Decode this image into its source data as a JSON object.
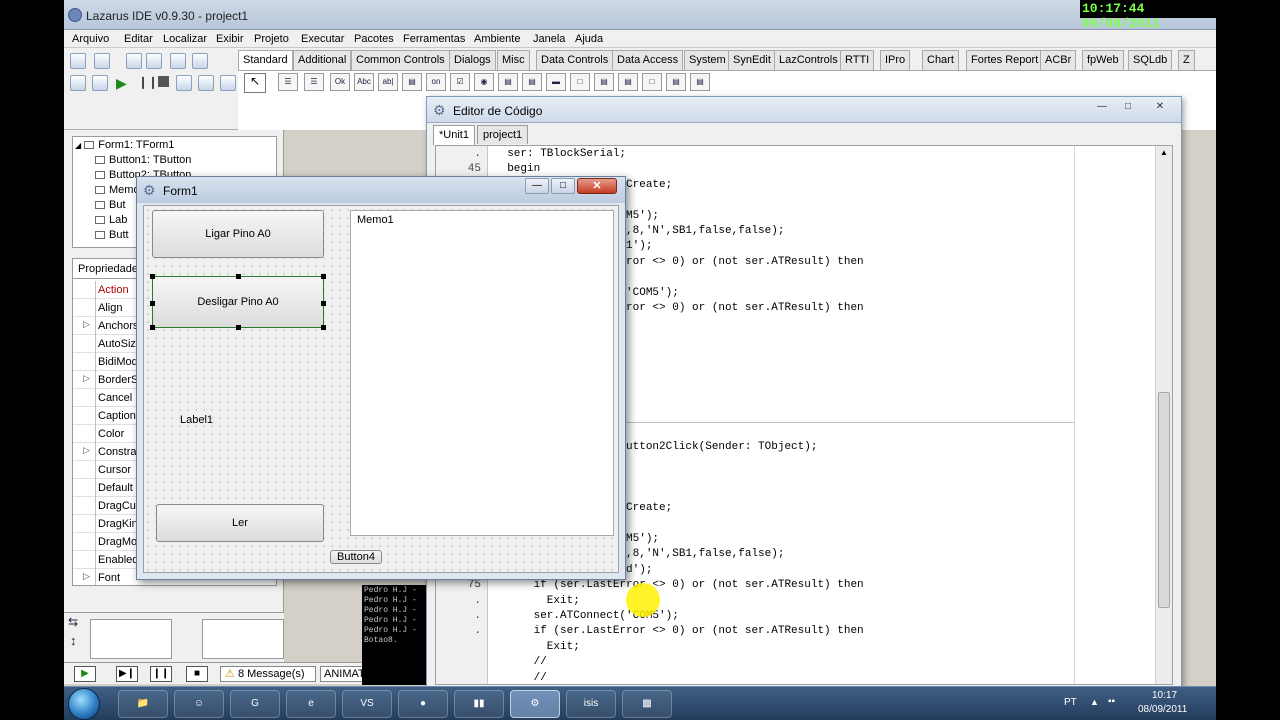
{
  "window_title": "Lazarus IDE v0.9.30 - project1",
  "clock_overlay": "10:17:44  09/08/2011",
  "menu": [
    "Arquivo",
    "Editar",
    "Localizar",
    "Exibir",
    "Projeto",
    "Executar",
    "Pacotes",
    "Ferramentas",
    "Ambiente",
    "Janela",
    "Ajuda"
  ],
  "palette_tabs": [
    "Standard",
    "Additional",
    "Common Controls",
    "Dialogs",
    "Misc",
    "Data Controls",
    "Data Access",
    "System",
    "SynEdit",
    "LazControls",
    "RTTI",
    "IPro",
    "Chart",
    "Fortes Report",
    "ACBr",
    "fpWeb",
    "SQLdb",
    "Z"
  ],
  "palette_components": [
    "Ok",
    "Abc",
    "ab|",
    "on"
  ],
  "object_tree": [
    "Form1: TForm1",
    "Button1: TButton",
    "Button2: TButton",
    "Memo",
    "But",
    "Lab",
    "Butt"
  ],
  "inspector_tab": "Propriedades",
  "properties": [
    "Action",
    "Align",
    "Anchors",
    "AutoSize",
    "BidiMode",
    "BorderSpacing",
    "Cancel",
    "Caption",
    "Color",
    "Constraints",
    "Cursor",
    "Default",
    "DragCursor",
    "DragKind",
    "DragMode",
    "Enabled",
    "Font"
  ],
  "messages_count": "8 Message(s)",
  "status_animat": "ANIMAT",
  "terminal_lines": [
    "Pedro H.J -",
    "Pedro H.J -",
    "Pedro H.J -",
    "Pedro H.J -",
    "Pedro H.J -",
    "Botao8."
  ],
  "editor": {
    "title": "Editor de Código",
    "tabs": [
      "*Unit1",
      "project1"
    ],
    "line_numbers": [
      ".",
      "45",
      ".",
      ".",
      ".",
      ".",
      ".",
      ".",
      ".",
      ".",
      ".",
      "",
      "",
      "",
      "",
      "",
      "",
      "",
      "",
      ".",
      ".",
      ".",
      ".",
      ".",
      ".",
      ".",
      ".",
      ".",
      "75",
      ".",
      ".",
      "."
    ],
    "code_lines": [
      "  ser: TBlockSerial;",
      "  begin",
      "                  l.Create;",
      "",
      "                  COM5');",
      "                  00,8,'N',SB1,false,false);",
      "                  ('1');",
      "                  Error <> 0) or (not ser.ATResult) then",
      "",
      "                  t('COM5');",
      "                  Error <> 0) or (not ser.ATResult) then",
      "",
      "",
      "",
      "",
      "",
      "",
      "",
      "",
      "                  .Button2Click(Sender: TObject);",
      "",
      "                  l;",
      "",
      "                  l.Create;",
      "",
      "                  COM5');",
      "                  00,8,'N',SB1,false,false);",
      "                  ('d');",
      "      if (ser.LastError <> 0) or (not ser.ATResult) then",
      "        Exit;",
      "      ser.ATConnect('COM5');",
      "      if (ser.LastError <> 0) or (not ser.ATResult) then",
      "        Exit;",
      "      //",
      "      //"
    ]
  },
  "form1": {
    "title": "Form1",
    "button_ligar": "Ligar Pino A0",
    "button_desligar": "Desligar Pino A0",
    "label": "Label1",
    "button_ler": "Ler",
    "memo": "Memo1",
    "button4": "Button4"
  },
  "taskbar": {
    "lang": "PT",
    "time": "10:17",
    "date": "08/09/2011",
    "items": [
      "explorer",
      "people",
      "gimp",
      "ie",
      "vsc",
      "rc",
      "mid",
      "lazarus",
      "isis",
      "cmd"
    ]
  }
}
